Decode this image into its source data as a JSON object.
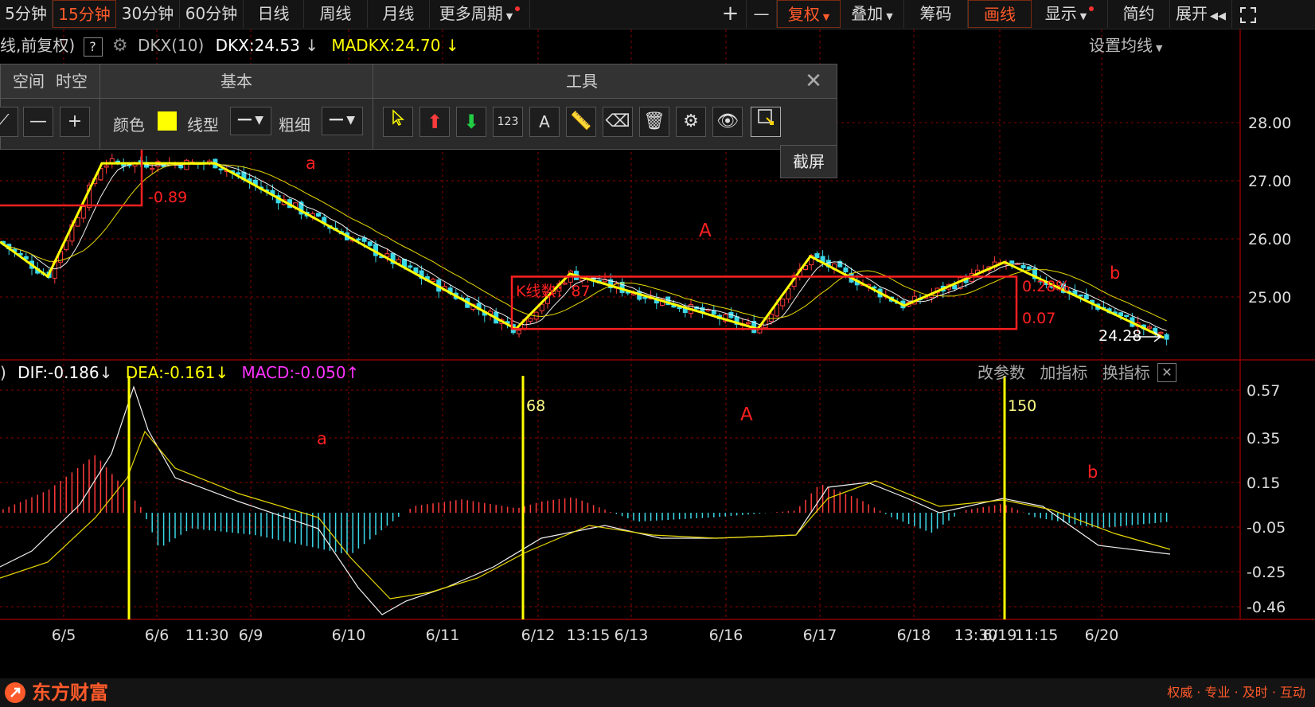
{
  "toolbar": {
    "periods": [
      "5分钟",
      "15分钟",
      "30分钟",
      "60分钟",
      "日线",
      "周线",
      "月线",
      "更多周期"
    ],
    "active_period": "15分钟",
    "right_buttons": [
      "+",
      "—",
      "复权",
      "叠加",
      "筹码",
      "画线",
      "显示",
      "简约",
      "展开"
    ]
  },
  "info": {
    "prefix": "线,前复权)",
    "help": "?",
    "indicator": "DKX(10)",
    "dkx": "DKX:24.53",
    "madkx": "MADKX:24.70",
    "settings": "设置均线"
  },
  "draw_panel": {
    "headers": [
      "空间",
      "时空",
      "基本",
      "工具"
    ],
    "color_label": "颜色",
    "linetype_label": "线型",
    "thickness_label": "粗细",
    "tooltip": "截屏",
    "tool_text_123": "123",
    "tool_text_a": "A"
  },
  "macd_info": {
    "paren": ")",
    "dif": "DIF:-0.186",
    "dea": "DEA:-0.161",
    "macd": "MACD:-0.050",
    "buttons": [
      "改参数",
      "加指标",
      "换指标"
    ]
  },
  "colors": {
    "up": "#ff3b3b",
    "down": "#3bd8e8",
    "yellow": "#ffff00",
    "magenta": "#ff33ff",
    "accent": "#ff5a2a",
    "grid": "#8b0000"
  },
  "chart_data": [
    {
      "type": "line",
      "title": "",
      "y_ticks": [
        "28.00",
        "27.00",
        "26.00",
        "25.00"
      ],
      "annotations": {
        "wave_labels": [
          "a",
          "A",
          "b"
        ],
        "rect1_value": "-0.89",
        "box_count_label": "K线数：87",
        "box_pct": "0.28%",
        "box_height": "0.07",
        "last_price": "24.28"
      },
      "box_top": 25.35,
      "box_bottom": 24.45,
      "zigzag": [
        {
          "x": 0,
          "y": 25.95
        },
        {
          "x": 60,
          "y": 25.35
        },
        {
          "x": 128,
          "y": 27.3
        },
        {
          "x": 270,
          "y": 27.3
        },
        {
          "x": 648,
          "y": 24.45
        },
        {
          "x": 716,
          "y": 25.4
        },
        {
          "x": 952,
          "y": 24.45
        },
        {
          "x": 1018,
          "y": 25.7
        },
        {
          "x": 1136,
          "y": 24.85
        },
        {
          "x": 1262,
          "y": 25.6
        },
        {
          "x": 1462,
          "y": 24.3
        }
      ]
    },
    {
      "type": "bar",
      "title": "MACD",
      "y_ticks": [
        "0.57",
        "0.35",
        "0.15",
        "-0.05",
        "-0.25",
        "-0.46"
      ],
      "annotations": {
        "wave_labels": [
          "a",
          "A",
          "b"
        ],
        "marker_labels": [
          "68",
          "150"
        ]
      }
    }
  ],
  "x_axis": [
    "6/5",
    "6/6",
    "11:30",
    "6/9",
    "6/10",
    "6/11",
    "6/12",
    "13:15",
    "6/13",
    "6/16",
    "6/17",
    "6/18",
    "13:30",
    "6/19",
    "11:15",
    "6/20"
  ],
  "brand": {
    "name": "东方财富",
    "slogan": "权威 · 专业 · 及时 · 互动"
  }
}
